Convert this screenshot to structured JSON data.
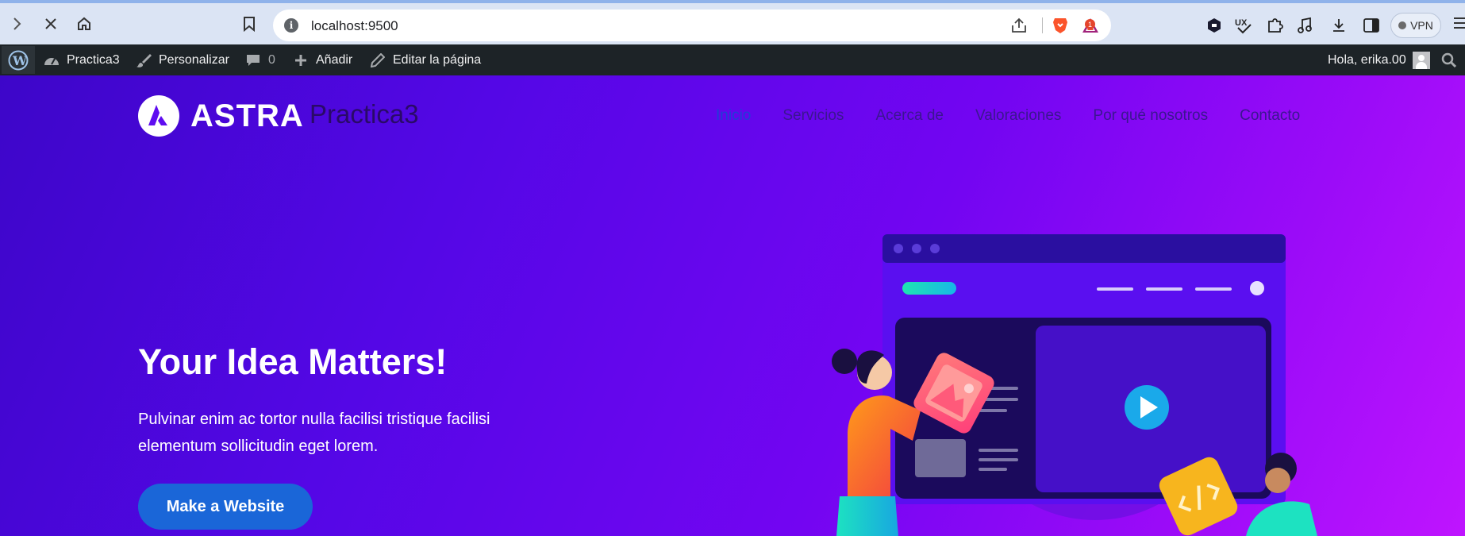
{
  "browser": {
    "url": "localhost:9500",
    "notification_count": "1",
    "vpn_label": "VPN"
  },
  "admin_bar": {
    "site_name": "Practica3",
    "customize": "Personalizar",
    "comments_count": "0",
    "add_new": "Añadir",
    "edit_page": "Editar la página",
    "greeting": "Hola, erika.00"
  },
  "site": {
    "logo_text": "ASTRA",
    "title": "Practica3",
    "nav": [
      "Inicio",
      "Servicios",
      "Acerca de",
      "Valoraciones",
      "Por qué nosotros",
      "Contacto"
    ]
  },
  "hero": {
    "title": "Your Idea Matters!",
    "text": "Pulvinar enim ac tortor nulla facilisi tristique facilisi elementum sollicitudin eget lorem.",
    "cta": "Make a Website"
  },
  "colors": {
    "accent": "#1a66d8",
    "admin_bar": "#1d2327",
    "gradient_start": "#3d06c9",
    "gradient_end": "#bf14ff"
  }
}
